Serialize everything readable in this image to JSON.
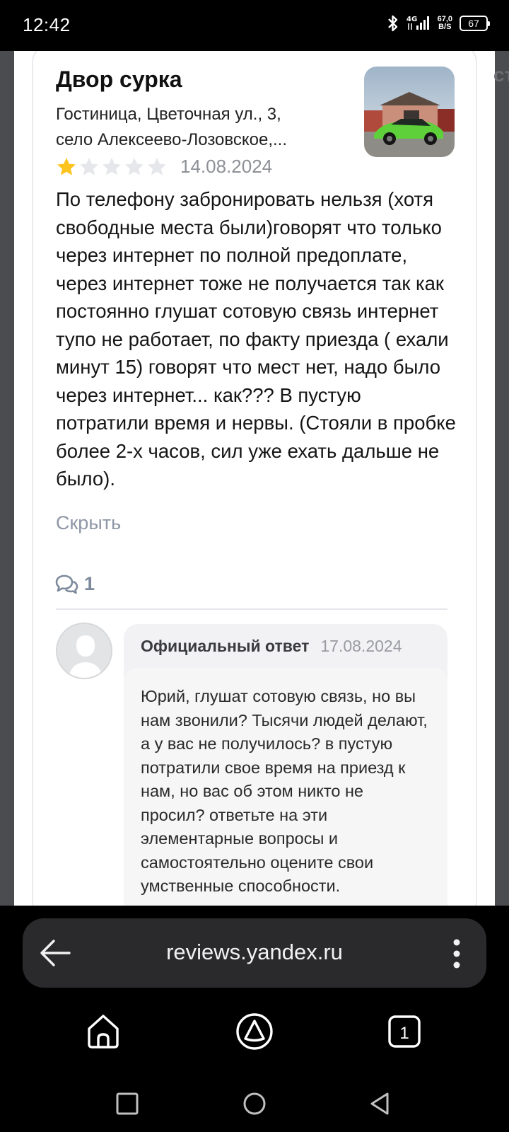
{
  "status_bar": {
    "time": "12:42",
    "network_type": "4G",
    "net_speed_value": "67,0",
    "net_speed_unit": "B/S",
    "battery": "67"
  },
  "review": {
    "org_name": "Двор сурка",
    "org_address_line1": "Гостиница, Цветочная ул., 3,",
    "org_address_line2": "село Алексеево-Лозовское,...",
    "rating": 1,
    "rating_max": 5,
    "date": "14.08.2024",
    "text": "По телефону забронировать  нельзя (хотя свободные места были)говорят что только через интернет по полной предоплате, через интернет тоже не получается так как постоянно глушат сотовую связь интернет тупо не работает, по факту приезда ( ехали минут 15) говорят что мест нет, надо было через интернет... как???  В пустую потратили время и нервы. (Стояли в пробке более 2-х часов, сил уже ехать дальше не было).",
    "hide_label": "Скрыть",
    "comments_count": "1"
  },
  "official_reply": {
    "title": "Официальный ответ",
    "date": "17.08.2024",
    "text": "Юрий, глушат сотовую связь, но вы нам звонили? Тысячи людей делают, а у вас не получилось? в пустую потратили свое время на приезд к нам, но вас об этом никто не просил? ответьте на эти элементарные вопросы и самостоятельно оцените свои умственные способности."
  },
  "browser": {
    "url": "reviews.yandex.ru",
    "tabs_count": "1"
  },
  "colors": {
    "star_filled": "#fdc31f",
    "star_empty": "#e6e7ea",
    "page_background": "#ffffff",
    "browser_bar": "#2a2a2c"
  }
}
